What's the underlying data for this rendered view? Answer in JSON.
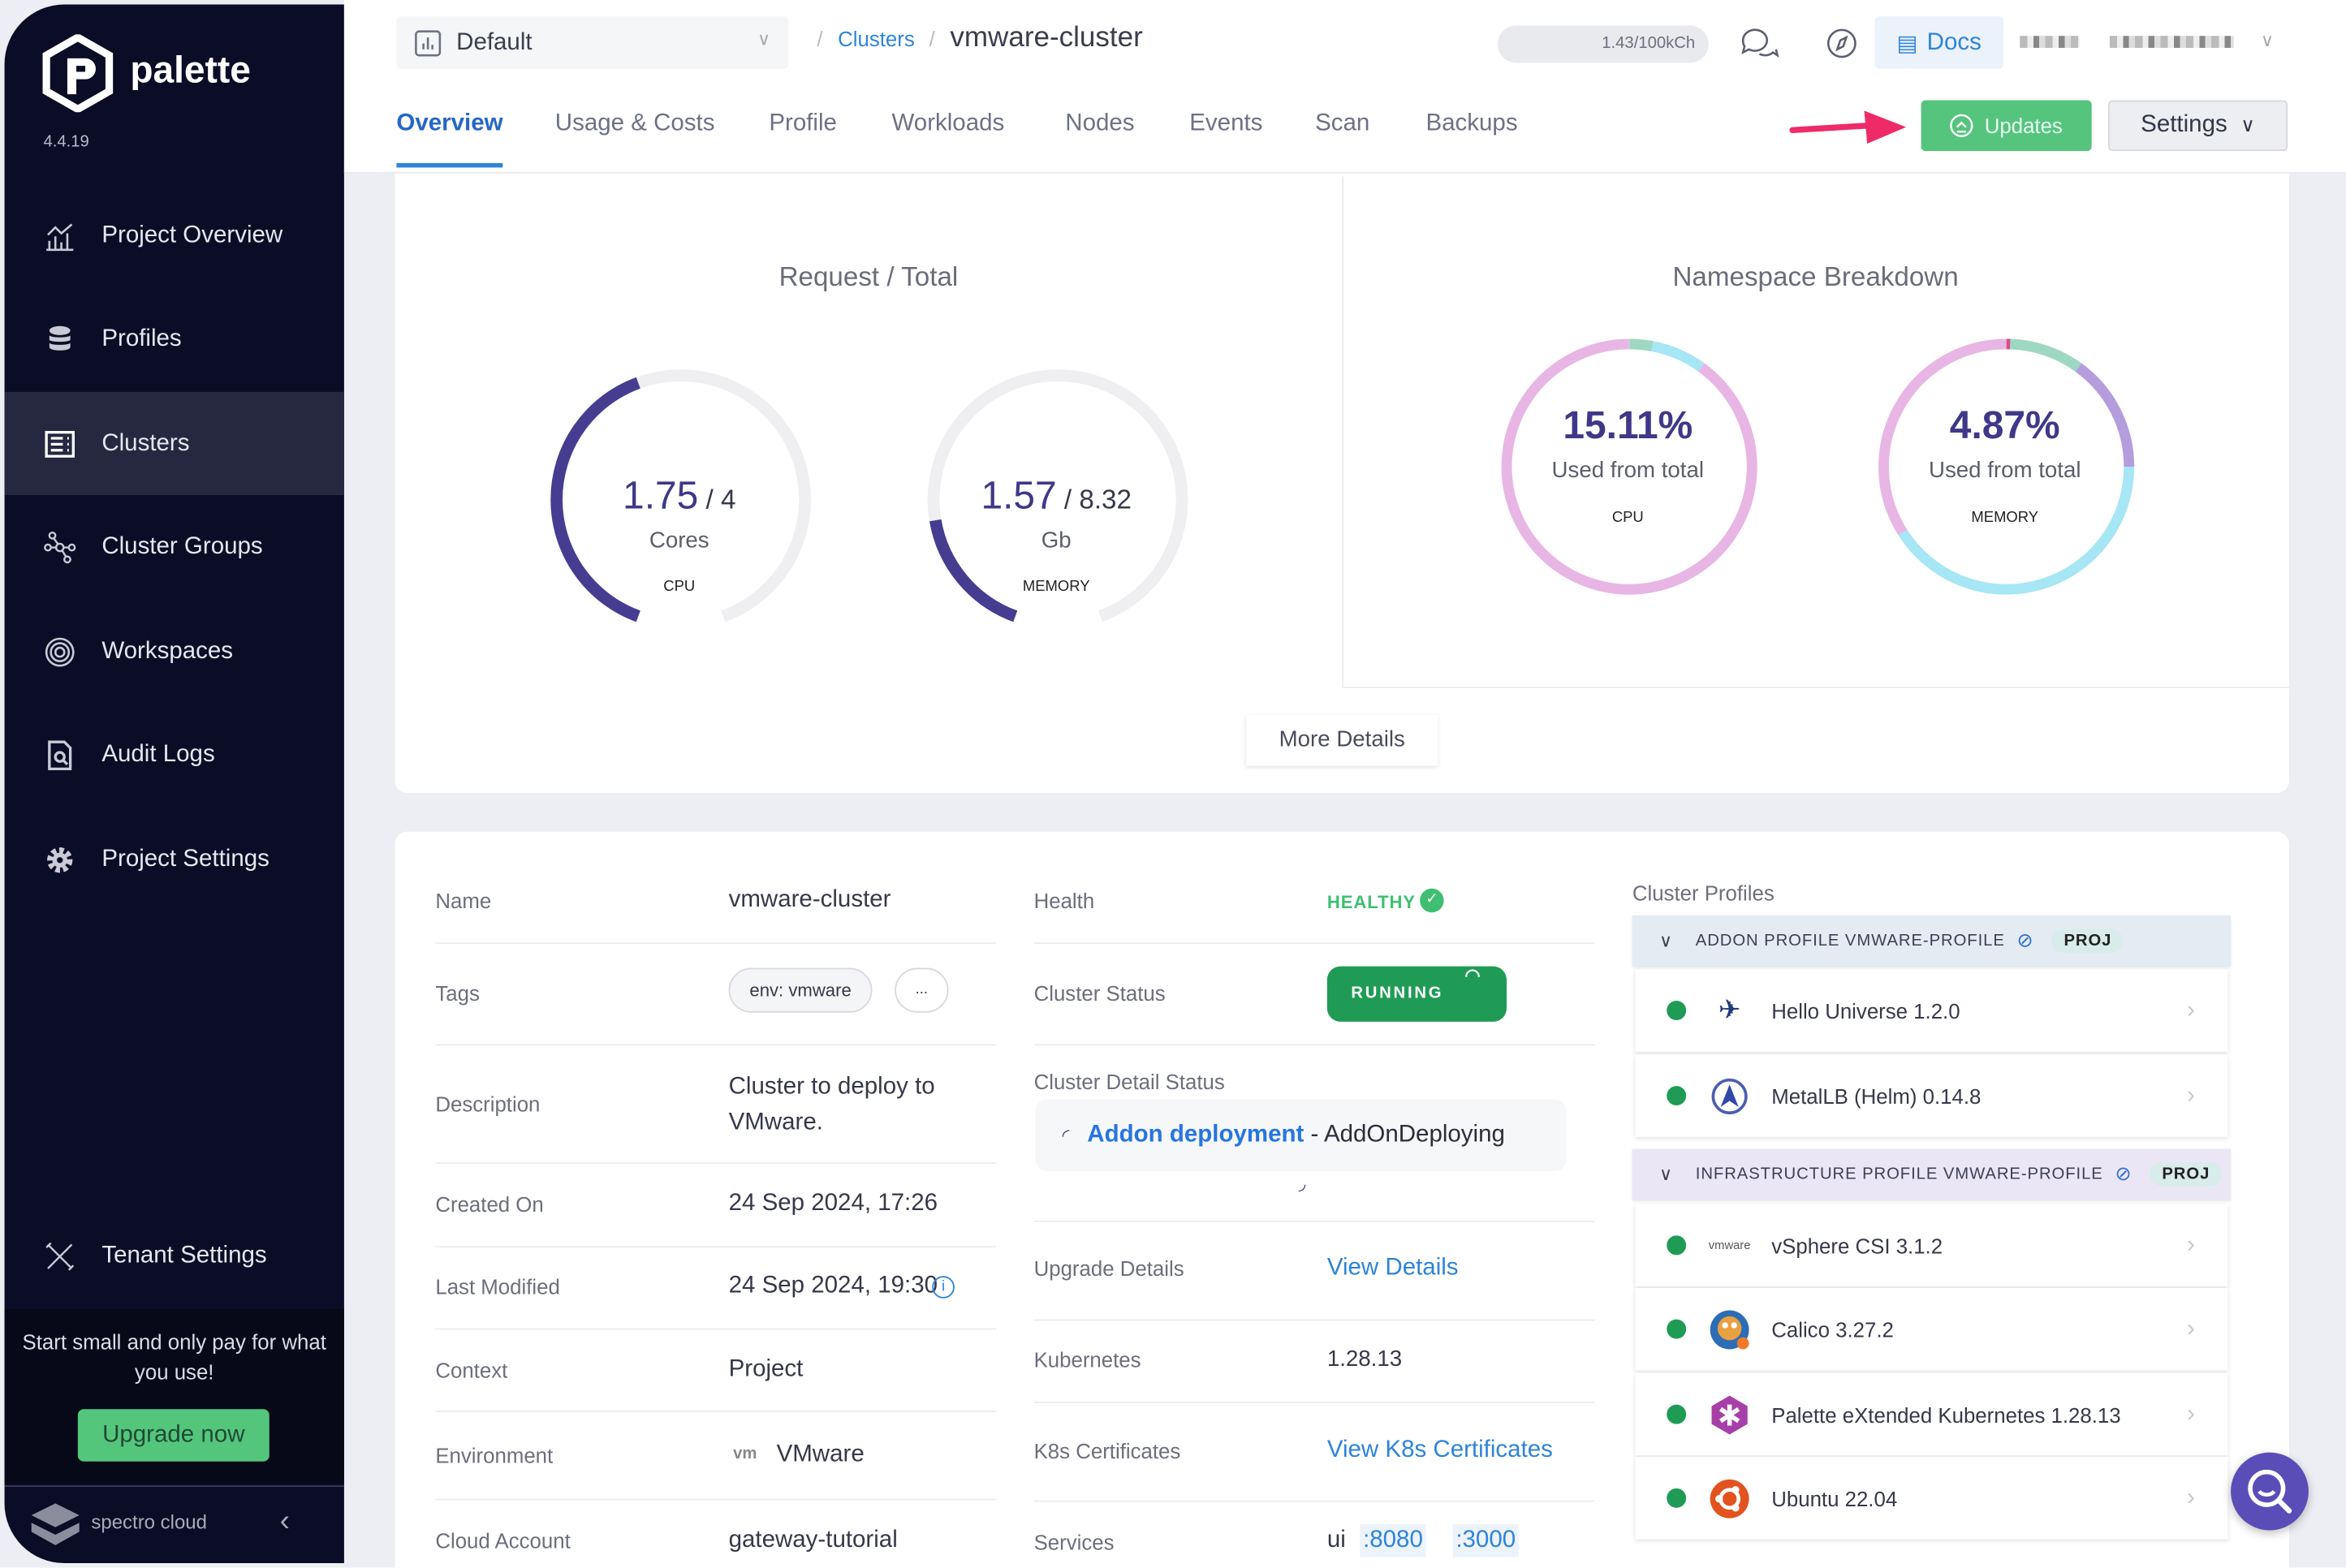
{
  "sidebar": {
    "brand": "palette",
    "version": "4.4.19",
    "items": [
      {
        "label": "Project Overview",
        "icon": "chart-icon"
      },
      {
        "label": "Profiles",
        "icon": "database-icon"
      },
      {
        "label": "Clusters",
        "icon": "list-icon",
        "active": true
      },
      {
        "label": "Cluster Groups",
        "icon": "network-icon"
      },
      {
        "label": "Workspaces",
        "icon": "target-icon"
      },
      {
        "label": "Audit Logs",
        "icon": "search-doc-icon"
      },
      {
        "label": "Project Settings",
        "icon": "gear-icon"
      },
      {
        "label": "Tenant Settings",
        "icon": "tools-icon"
      }
    ],
    "promo_text": "Start small and only pay for what you use!",
    "upgrade_label": "Upgrade now",
    "footer_brand": "spectro cloud"
  },
  "header": {
    "project": "Default",
    "breadcrumb": {
      "parent": "Clusters",
      "current": "vmware-cluster"
    },
    "credits": "1.43/100kCh",
    "docs_label": "Docs",
    "tabs": [
      "Overview",
      "Usage & Costs",
      "Profile",
      "Workloads",
      "Nodes",
      "Events",
      "Scan",
      "Backups"
    ],
    "active_tab": "Overview",
    "updates_label": "Updates",
    "settings_label": "Settings"
  },
  "usage": {
    "request_title": "Request / Total",
    "gauges": [
      {
        "value": "1.75",
        "total": "4",
        "unit": "Cores",
        "label": "CPU",
        "fraction": 0.4375
      },
      {
        "value": "1.57",
        "total": "8.32",
        "unit": "Gb",
        "label": "MEMORY",
        "fraction": 0.1887
      }
    ],
    "namespace_title": "Namespace Breakdown",
    "donuts": [
      {
        "percent": "15.11%",
        "caption": "Used from total",
        "label": "CPU",
        "segments": [
          {
            "fraction": 0.03,
            "color": "#9ed8c3"
          },
          {
            "fraction": 0.07,
            "color": "#a6e6f5"
          },
          {
            "fraction": 0.9,
            "color": "#e8b6e4"
          }
        ]
      },
      {
        "percent": "4.87%",
        "caption": "Used from total",
        "label": "MEMORY",
        "segments": [
          {
            "fraction": 0.005,
            "color": "#d64f8a"
          },
          {
            "fraction": 0.095,
            "color": "#9ed8c3"
          },
          {
            "fraction": 0.15,
            "color": "#b59ddd"
          },
          {
            "fraction": 0.41,
            "color": "#a6e6f5"
          },
          {
            "fraction": 0.34,
            "color": "#e8b6e4"
          }
        ]
      }
    ],
    "more_details_label": "More Details",
    "gauge_color": "#463d91",
    "track_color": "#efeff2"
  },
  "details": {
    "left": [
      {
        "label": "Name",
        "value": "vmware-cluster"
      },
      {
        "label": "Tags",
        "tags": [
          "env: vmware",
          "..."
        ]
      },
      {
        "label": "Description",
        "value": "Cluster to deploy to VMware."
      },
      {
        "label": "Created On",
        "value": "24 Sep 2024, 17:26"
      },
      {
        "label": "Last Modified",
        "value": "24 Sep 2024, 19:30"
      },
      {
        "label": "Context",
        "value": "Project"
      },
      {
        "label": "Environment",
        "value": "VMware",
        "icon_text": "vm"
      },
      {
        "label": "Cloud Account",
        "value": "gateway-tutorial"
      }
    ],
    "right": {
      "health_label": "Health",
      "health_value": "HEALTHY",
      "status_label": "Cluster Status",
      "status_value": "RUNNING",
      "detail_status_label": "Cluster Detail Status",
      "detail_status_link": "Addon deployment",
      "detail_status_text": "- AddOnDeploying",
      "upgrade_label": "Upgrade Details",
      "upgrade_link": "View Details",
      "k8s_label": "Kubernetes",
      "k8s_value": "1.28.13",
      "cert_label": "K8s Certificates",
      "cert_link": "View K8s Certificates",
      "services_label": "Services",
      "services_name": "ui",
      "services_ports": [
        ":8080",
        ":3000"
      ]
    }
  },
  "profiles": {
    "title": "Cluster Profiles",
    "groups": [
      {
        "header": "ADDON PROFILE VMWARE-PROFILE",
        "badge": "PROJ",
        "color": "#e4ebf3",
        "items": [
          {
            "name": "Hello Universe 1.2.0",
            "icon": "rocket-icon"
          },
          {
            "name": "MetalLB (Helm) 0.14.8",
            "icon": "metallb-icon"
          }
        ]
      },
      {
        "header": "INFRASTRUCTURE PROFILE VMWARE-PROFILE",
        "badge": "PROJ",
        "color": "#ebe6f5",
        "items": [
          {
            "name": "vSphere CSI 3.1.2",
            "icon": "vmware-icon",
            "icon_text": "vmware"
          },
          {
            "name": "Calico 3.27.2",
            "icon": "calico-icon"
          },
          {
            "name": "Palette eXtended Kubernetes 1.28.13",
            "icon": "kubernetes-icon"
          },
          {
            "name": "Ubuntu 22.04",
            "icon": "ubuntu-icon"
          }
        ]
      }
    ]
  }
}
